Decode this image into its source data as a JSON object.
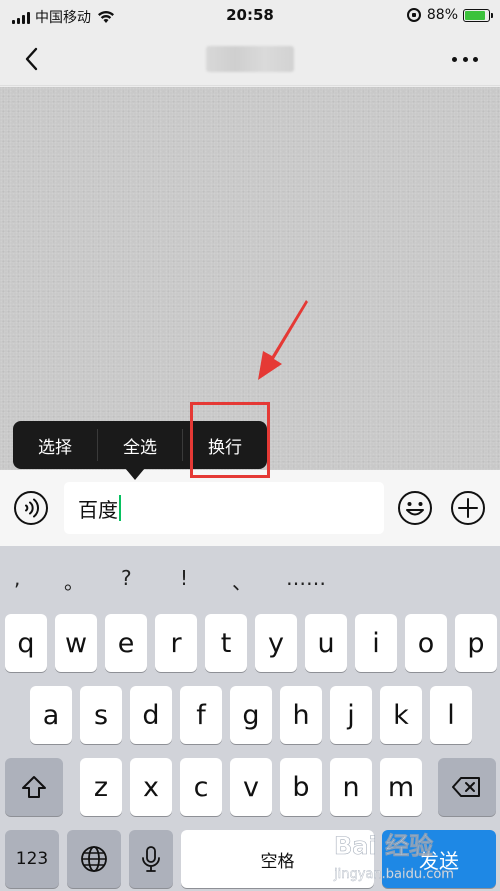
{
  "status_bar": {
    "carrier": "中国移动",
    "time": "20:58",
    "battery_percent": "88%",
    "battery_level": 0.88,
    "battery_color": "#3cc23c"
  },
  "context_menu": {
    "items": [
      "选择",
      "全选",
      "换行"
    ]
  },
  "input": {
    "value": "百度",
    "caret_color": "#07c160"
  },
  "keyboard": {
    "punctuation": [
      ",",
      "。",
      "?",
      "!",
      "、",
      "……"
    ],
    "row1": [
      "q",
      "w",
      "e",
      "r",
      "t",
      "y",
      "u",
      "i",
      "o",
      "p"
    ],
    "row2": [
      "a",
      "s",
      "d",
      "f",
      "g",
      "h",
      "j",
      "k",
      "l"
    ],
    "row3": [
      "z",
      "x",
      "c",
      "v",
      "b",
      "n",
      "m"
    ],
    "numbers_label": "123",
    "space_label": "空格",
    "send_label": "发送"
  },
  "watermark": {
    "text": "Bai 经验",
    "subtext": "jingyan.baidu.com"
  },
  "colors": {
    "annotation_red": "#e53935",
    "send_blue": "#1e88e5"
  }
}
